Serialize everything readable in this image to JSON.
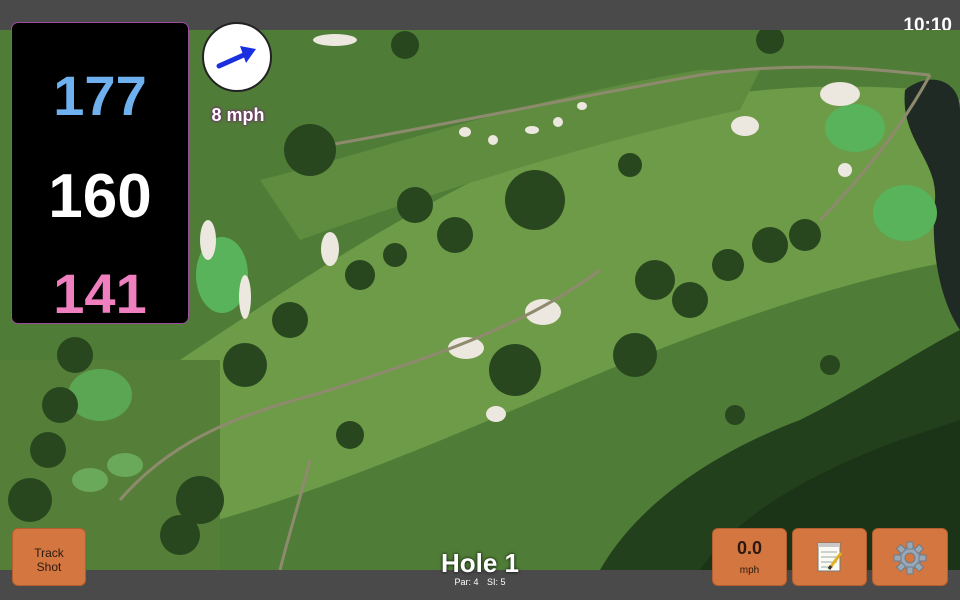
{
  "status": {
    "time": "10:10"
  },
  "yardage": {
    "back": "177",
    "middle": "160",
    "front": "141"
  },
  "wind": {
    "speed": "8 mph",
    "icon": "wind-arrow-icon"
  },
  "buttons": {
    "track_line1": "Track",
    "track_line2": "Shot",
    "speed_value": "0.0",
    "speed_unit": "mph",
    "notes_icon": "notepad-icon",
    "settings_icon": "gear-icon"
  },
  "hole": {
    "title": "Hole 1",
    "par": "Par: 4",
    "si": "SI: 5"
  },
  "colors": {
    "back": "#6fb0ee",
    "middle": "#ffffff",
    "front": "#f07fc0",
    "button": "#d4763f"
  }
}
